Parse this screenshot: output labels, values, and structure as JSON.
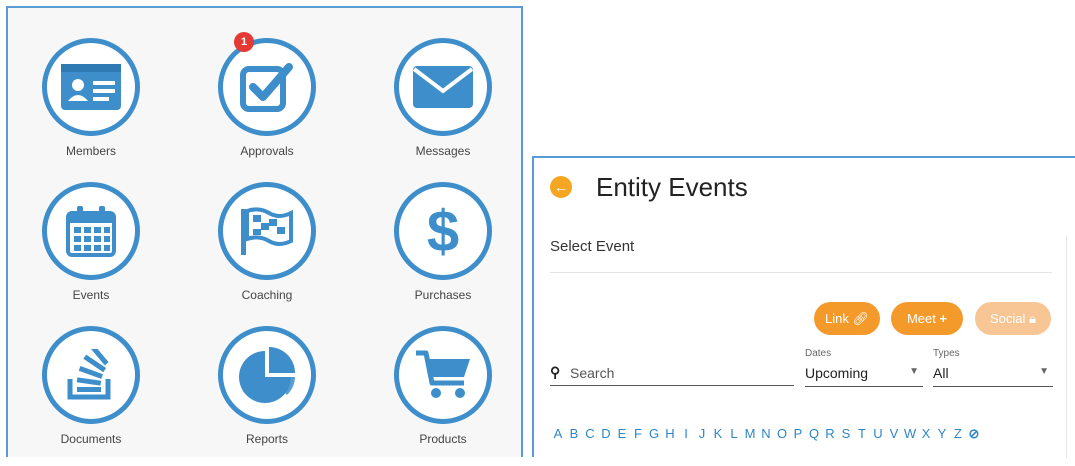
{
  "dashboard": {
    "tiles": [
      {
        "label": "Members",
        "icon": "id-card-icon"
      },
      {
        "label": "Approvals",
        "icon": "checkbox-icon",
        "badge": "1"
      },
      {
        "label": "Messages",
        "icon": "envelope-icon"
      },
      {
        "label": "Events",
        "icon": "calendar-icon"
      },
      {
        "label": "Coaching",
        "icon": "flag-icon"
      },
      {
        "label": "Purchases",
        "icon": "dollar-icon"
      },
      {
        "label": "Documents",
        "icon": "stack-icon"
      },
      {
        "label": "Reports",
        "icon": "pie-chart-icon"
      },
      {
        "label": "Products",
        "icon": "cart-icon"
      }
    ],
    "icon_color": "#3d8ecb",
    "badge_color": "#e53935"
  },
  "events": {
    "title": "Entity Events",
    "subtitle": "Select Event",
    "buttons": {
      "link": "Link",
      "meet": "Meet",
      "social": "Social"
    },
    "search": {
      "placeholder": "Search"
    },
    "dates": {
      "caption": "Dates",
      "value": "Upcoming"
    },
    "types": {
      "caption": "Types",
      "value": "All"
    },
    "alphabet": [
      "A",
      "B",
      "C",
      "D",
      "E",
      "F",
      "G",
      "H",
      "I",
      "J",
      "K",
      "L",
      "M",
      "N",
      "O",
      "P",
      "Q",
      "R",
      "S",
      "T",
      "U",
      "V",
      "W",
      "X",
      "Y",
      "Z"
    ],
    "accent_color": "#f39a2b"
  }
}
